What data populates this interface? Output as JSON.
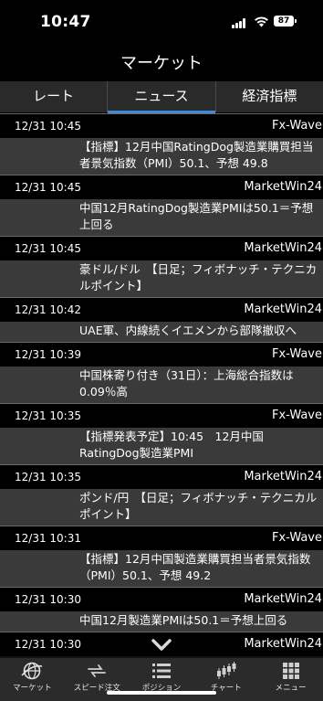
{
  "status": {
    "time": "10:47",
    "battery": "87"
  },
  "nav": {
    "title": "マーケット"
  },
  "tabs": [
    {
      "label": "レート"
    },
    {
      "label": "ニュース"
    },
    {
      "label": "経済指標"
    }
  ],
  "active_tab": "ニュース",
  "news": [
    {
      "time": "12/31 10:45",
      "source": "Fx-Wave",
      "text": "【指標】12月中国RatingDog製造業購買担当者景気指数（PMI）50.1、予想 49.8"
    },
    {
      "time": "12/31 10:45",
      "source": "MarketWin24",
      "text": "中国12月RatingDog製造業PMIは50.1＝予想上回る"
    },
    {
      "time": "12/31 10:45",
      "source": "MarketWin24",
      "text": "豪ドル/ドル　【日足；フィボナッチ・テクニカルポイント】"
    },
    {
      "time": "12/31 10:42",
      "source": "MarketWin24",
      "text": "UAE軍、内線続くイエメンから部隊撤収へ"
    },
    {
      "time": "12/31 10:39",
      "source": "Fx-Wave",
      "text": "中国株寄り付き（31日）：上海総合指数は0.09％高"
    },
    {
      "time": "12/31 10:35",
      "source": "Fx-Wave",
      "text": "【指標発表予定】10:45　12月中国RatingDog製造業PMI"
    },
    {
      "time": "12/31 10:35",
      "source": "MarketWin24",
      "text": "ポンド/円　【日足；フィボナッチ・テクニカルポイント】"
    },
    {
      "time": "12/31 10:31",
      "source": "Fx-Wave",
      "text": "【指標】12月中国製造業購買担当者景気指数（PMI）50.1、予想 49.2"
    },
    {
      "time": "12/31 10:30",
      "source": "MarketWin24",
      "text": "中国12月製造業PMIは50.1＝予想上回る"
    },
    {
      "time": "12/31 10:30",
      "source": "MarketWin24",
      "text": ""
    }
  ],
  "tabbar": [
    {
      "label": "マーケット",
      "icon": "globe-icon"
    },
    {
      "label": "スピード注文",
      "icon": "speed-order-icon"
    },
    {
      "label": "ポジション",
      "icon": "list-icon"
    },
    {
      "label": "チャート",
      "icon": "candlestick-icon"
    },
    {
      "label": "メニュー",
      "icon": "grid-menu-icon"
    }
  ],
  "colors": {
    "accent": "#3f8bd6",
    "background": "#000000",
    "row_body": "#3a3a3a",
    "tabbar": "#2b2b2b"
  }
}
